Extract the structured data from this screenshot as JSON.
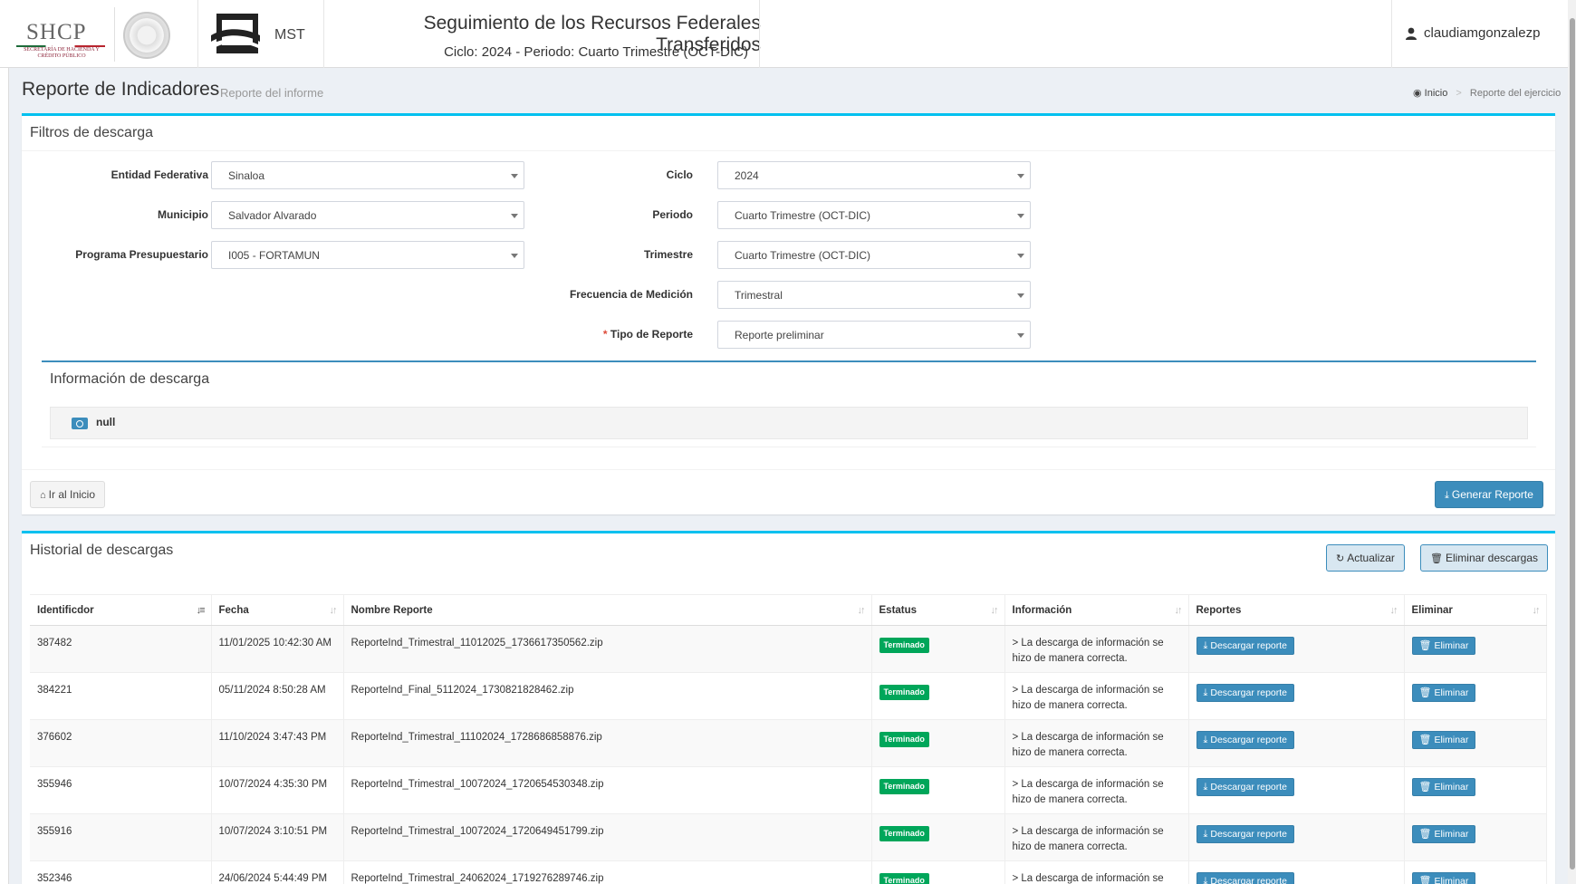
{
  "header": {
    "shcp_logo": "SHCP",
    "shcp_sub": "SECRETARÍA DE HACIENDA Y CRÉDITO PÚBLICO",
    "mst_label": "MST",
    "app_title": "Seguimiento de los Recursos Federales Transferidos",
    "app_subtitle": "Ciclo: 2024 - Periodo: Cuarto Trimestre (OCT-DIC)",
    "user_name": "claudiamgonzalezp"
  },
  "page": {
    "title": "Reporte de Indicadores",
    "subtitle": "Reporte del informe",
    "breadcrumb_home": "Inicio",
    "breadcrumb_current": "Reporte del ejercicio"
  },
  "filters": {
    "title": "Filtros de descarga",
    "entidad_label": "Entidad Federativa",
    "entidad_value": "Sinaloa",
    "municipio_label": "Municipio",
    "municipio_value": "Salvador Alvarado",
    "programa_label": "Programa Presupuestario",
    "programa_value": "I005 - FORTAMUN",
    "ciclo_label": "Ciclo",
    "ciclo_value": "2024",
    "periodo_label": "Periodo",
    "periodo_value": "Cuarto Trimestre (OCT-DIC)",
    "trimestre_label": "Trimestre",
    "trimestre_value": "Cuarto Trimestre (OCT-DIC)",
    "frecuencia_label": "Frecuencia de Medición",
    "frecuencia_value": "Trimestral",
    "tipo_required": "*",
    "tipo_label": "Tipo de Reporte",
    "tipo_value": "Reporte preliminar",
    "info_title": "Información de descarga",
    "info_value": "null",
    "home_button": "Ir al Inicio",
    "generate_button": "Generar Reporte"
  },
  "history": {
    "title": "Historial de descargas",
    "refresh_button": "Actualizar",
    "delete_all_button": "Eliminar descargas",
    "columns": [
      "Identificdor",
      "Fecha",
      "Nombre Reporte",
      "Estatus",
      "Información",
      "Reportes",
      "Eliminar"
    ],
    "status_label": "Terminado",
    "download_label": "Descargar reporte",
    "delete_label": "Eliminar",
    "info_line1": "> La descarga de información se",
    "info_line2": "hizo de manera correcta.",
    "rows": [
      {
        "id": "387482",
        "fecha": "11/01/2025 10:42:30 AM",
        "nombre": "ReporteInd_Trimestral_11012025_1736617350562.zip"
      },
      {
        "id": "384221",
        "fecha": "05/11/2024 8:50:28 AM",
        "nombre": "ReporteInd_Final_5112024_1730821828462.zip"
      },
      {
        "id": "376602",
        "fecha": "11/10/2024 3:47:43 PM",
        "nombre": "ReporteInd_Trimestral_11102024_1728686858876.zip"
      },
      {
        "id": "355946",
        "fecha": "10/07/2024 4:35:30 PM",
        "nombre": "ReporteInd_Trimestral_10072024_1720654530348.zip"
      },
      {
        "id": "355916",
        "fecha": "10/07/2024 3:10:51 PM",
        "nombre": "ReporteInd_Trimestral_10072024_1720649451799.zip"
      },
      {
        "id": "352346",
        "fecha": "24/06/2024 5:44:49 PM",
        "nombre": "ReporteInd_Trimestral_24062024_1719276289746.zip"
      }
    ]
  },
  "colors": {
    "primary": "#3c8dbc",
    "info_border": "#00c0ef",
    "success": "#00a65a",
    "required": "#dd4b39"
  }
}
